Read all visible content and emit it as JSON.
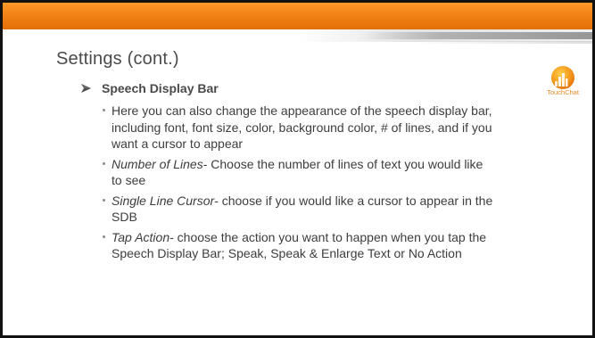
{
  "slide": {
    "title": "Settings (cont.)",
    "heading": "Speech Display Bar",
    "logo_text": "TouchChat",
    "bullets": [
      {
        "term": "",
        "text": "Here you can also change the appearance of the speech display bar, including font, font size, color, background color, # of lines, and if you want a cursor to appear"
      },
      {
        "term": "Number of Lines",
        "text": "- Choose the number of lines of text you would like to see"
      },
      {
        "term": "Single Line Cursor",
        "text": "- choose if you would like a cursor to appear in the SDB"
      },
      {
        "term": "Tap Action",
        "text": "- choose the action you want to happen when you tap the Speech Display Bar; Speak, Speak & Enlarge Text or No Action"
      }
    ]
  },
  "colors": {
    "accent": "#f07e12",
    "text": "#3d3d3d",
    "logo": "#e98a22"
  },
  "icons": {
    "heading_bullet": "arrow-right-icon",
    "logo": "touchchat-logo-icon"
  }
}
